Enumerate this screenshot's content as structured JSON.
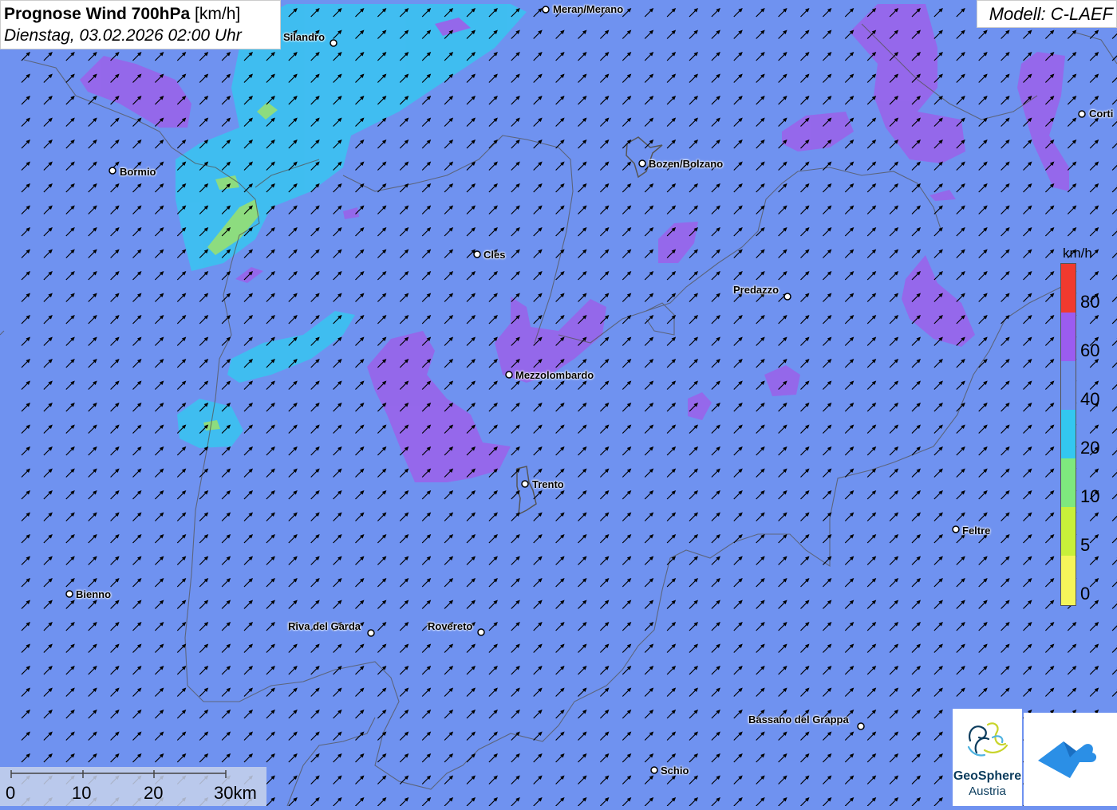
{
  "header": {
    "title_bold": "Prognose Wind 700hPa",
    "title_unit": "[km/h]",
    "datetime": "Dienstag, 03.02.2026 02:00 Uhr"
  },
  "model": {
    "label": "Modell: C-LAEF"
  },
  "cities": [
    {
      "name": "Meran/Merano"
    },
    {
      "name": "Silandro"
    },
    {
      "name": "Bormio"
    },
    {
      "name": "Bozen/Bolzano"
    },
    {
      "name": "Cles"
    },
    {
      "name": "Predazzo"
    },
    {
      "name": "Mezzolombardo"
    },
    {
      "name": "Trento"
    },
    {
      "name": "Feltre"
    },
    {
      "name": "Bienno"
    },
    {
      "name": "Riva del Garda"
    },
    {
      "name": "Rovereto"
    },
    {
      "name": "Bassano del Grappa"
    },
    {
      "name": "Schio"
    },
    {
      "name": "Corti"
    }
  ],
  "legend": {
    "unit": "km/h",
    "ticks": [
      "80",
      "60",
      "40",
      "20",
      "10",
      "5",
      "0"
    ],
    "colors": [
      "#f03a2e",
      "#9b5cf0",
      "#6f92f0",
      "#33c7f0",
      "#7ee87e",
      "#c8f03a",
      "#f5f55a"
    ]
  },
  "scale": {
    "labels": [
      "0",
      "10",
      "20",
      "30km"
    ]
  },
  "logos": {
    "geosphere_line1": "GeoSphere",
    "geosphere_line2": "Austria"
  },
  "colors": {
    "base": "#6f92f0",
    "arrow": "#000000"
  }
}
